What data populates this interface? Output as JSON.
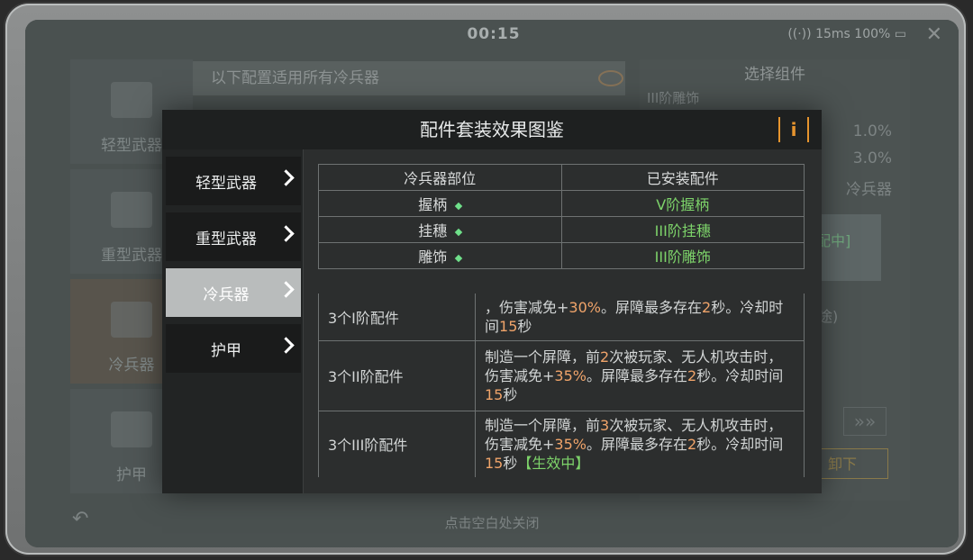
{
  "status": {
    "time": "00:15",
    "network": "15ms",
    "battery": "100%"
  },
  "background": {
    "tabs": [
      "轻型武器",
      "重型武器",
      "冷兵器",
      "护甲"
    ],
    "banner": "以下配置适用所有冷兵器",
    "right_title": "选择组件",
    "right_sub": "III阶雕饰",
    "values": [
      "1.0%",
      "3.0%"
    ],
    "right_label": "冷兵器",
    "slot_text": "配中]",
    "deco_text": "途)",
    "arrows": "»»",
    "button_text": "卸下",
    "hint": "点击空白处关闭"
  },
  "modal": {
    "title": "配件套装效果图鉴",
    "info_label": "i",
    "nav": [
      {
        "label": "轻型武器",
        "active": false
      },
      {
        "label": "重型武器",
        "active": false
      },
      {
        "label": "冷兵器",
        "active": true
      },
      {
        "label": "护甲",
        "active": false
      }
    ],
    "parts_table": {
      "headers": [
        "冷兵器部位",
        "已安装配件"
      ],
      "rows": [
        {
          "part": "握柄",
          "installed": "V阶握柄"
        },
        {
          "part": "挂穗",
          "installed": "III阶挂穗"
        },
        {
          "part": "雕饰",
          "installed": "III阶雕饰"
        }
      ]
    },
    "effects": [
      {
        "name": "3个I阶配件",
        "desc_1": "，伤害减免+",
        "num_1": "30%",
        "desc_2": "。屏障最多存在",
        "num_2": "2",
        "desc_3": "秒。冷却时间",
        "num_3": "15",
        "desc_4": "秒",
        "status": ""
      },
      {
        "name": "3个II阶配件",
        "pre": "制造一个屏障，前",
        "count": "2",
        "mid": "次被玩家、无人机攻击时，伤害减免+",
        "num_1": "35%",
        "desc_2": "。屏障最多存在",
        "num_2": "2",
        "desc_3": "秒。冷却时间",
        "num_3": "15",
        "desc_4": "秒",
        "status": ""
      },
      {
        "name": "3个III阶配件",
        "pre": "制造一个屏障，前",
        "count": "3",
        "mid": "次被玩家、无人机攻击时，伤害减免+",
        "num_1": "35%",
        "desc_2": "。屏障最多存在",
        "num_2": "2",
        "desc_3": "秒。冷却时间",
        "num_3": "15",
        "desc_4": "秒",
        "status": "【生效中】"
      }
    ]
  }
}
